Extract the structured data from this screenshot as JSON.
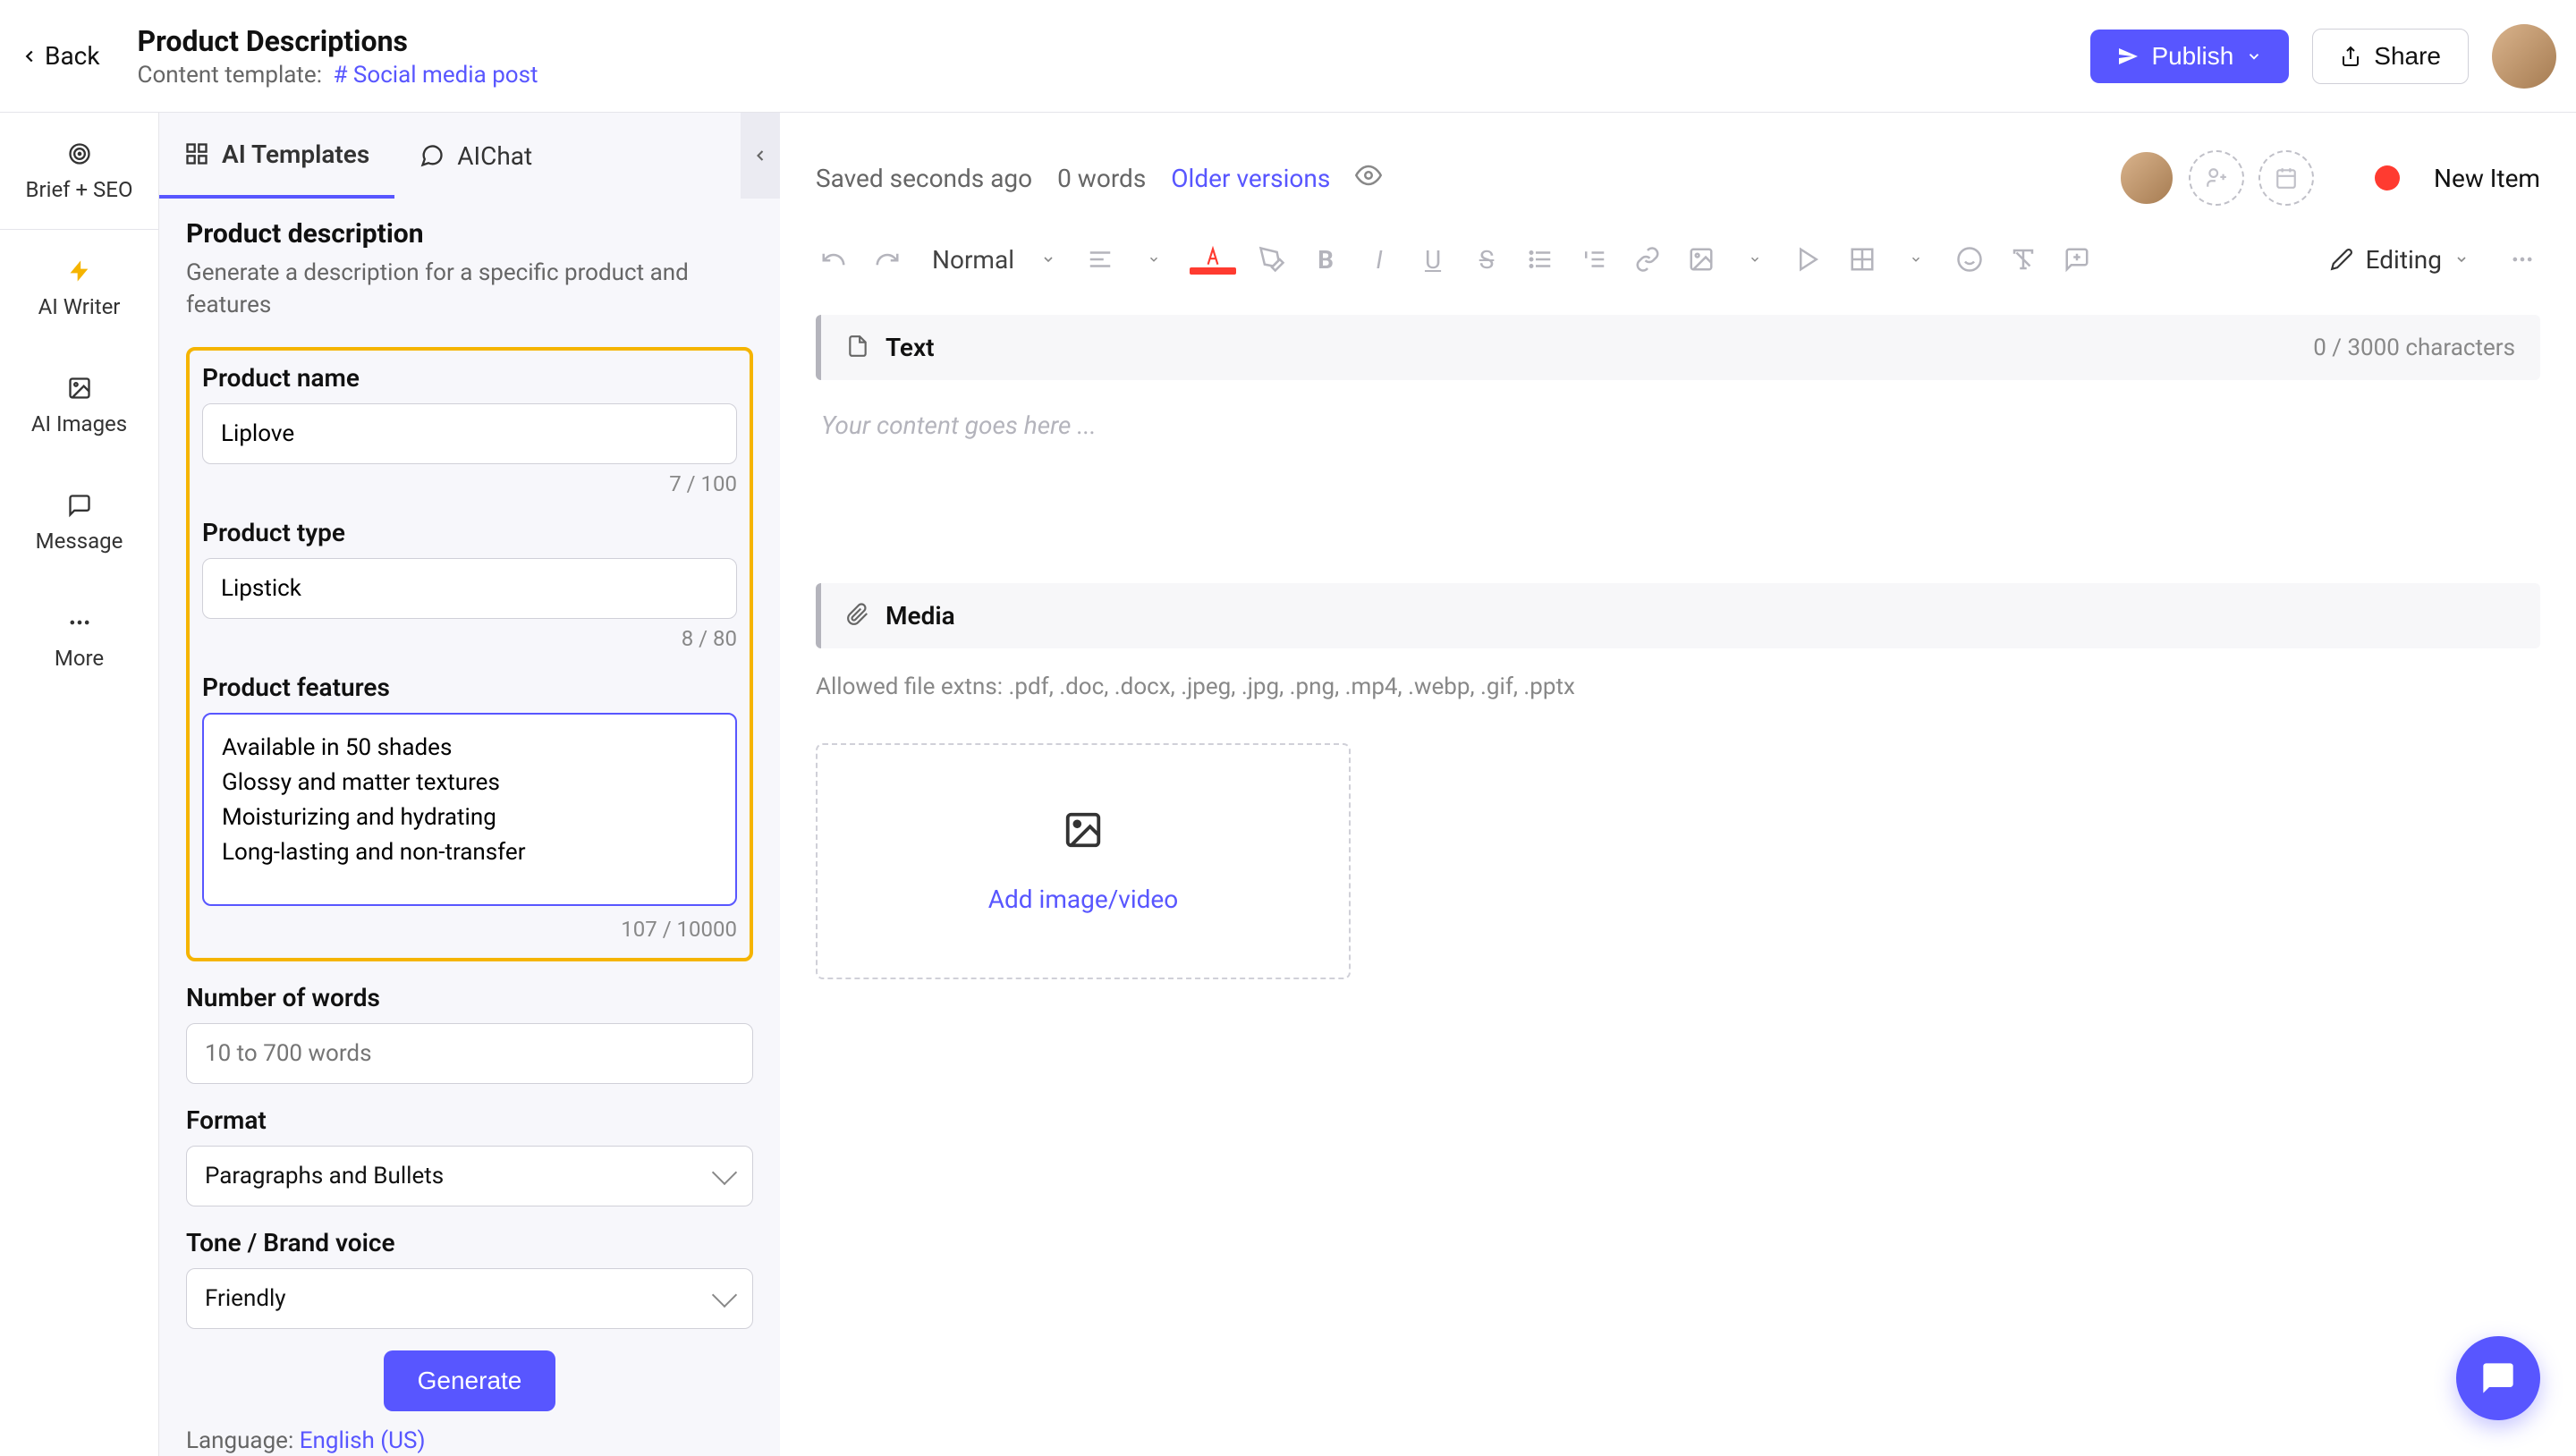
{
  "header": {
    "back_label": "Back",
    "title": "Product Descriptions",
    "subtitle_prefix": "Content template:",
    "template_tag": "Social media post",
    "publish_label": "Publish",
    "share_label": "Share"
  },
  "leftnav": {
    "items": [
      {
        "label": "Brief + SEO"
      },
      {
        "label": "AI Writer"
      },
      {
        "label": "AI Images"
      },
      {
        "label": "Message"
      },
      {
        "label": "More"
      }
    ]
  },
  "panel": {
    "tab_templates": "AI Templates",
    "tab_chat": "AIChat",
    "section_title": "Product description",
    "section_desc": "Generate a description for a specific product and features",
    "product_name_label": "Product name",
    "product_name_value": "Liplove",
    "product_name_count": "7 / 100",
    "product_type_label": "Product type",
    "product_type_value": "Lipstick",
    "product_type_count": "8 / 80",
    "features_label": "Product features",
    "features_value": "Available in 50 shades\nGlossy and matter textures\nMoisturizing and hydrating\nLong-lasting and non-transfer",
    "features_count": "107 / 10000",
    "numwords_label": "Number of words",
    "numwords_placeholder": "10 to 700 words",
    "format_label": "Format",
    "format_value": "Paragraphs and Bullets",
    "tone_label": "Tone / Brand voice",
    "tone_value": "Friendly",
    "generate_label": "Generate",
    "language_prefix": "Language:",
    "language_value": "English (US)"
  },
  "editor": {
    "saved_text": "Saved seconds ago",
    "word_count": "0 words",
    "older_versions": "Older versions",
    "status_label": "New Item",
    "style_select": "Normal",
    "mode_label": "Editing",
    "text_block_label": "Text",
    "text_char_counter": "0 / 3000 characters",
    "text_placeholder": "Your content goes here ...",
    "media_label": "Media",
    "media_hint": "Allowed file extns: .pdf, .doc, .docx, .jpeg, .jpg, .png, .mp4, .webp, .gif, .pptx",
    "media_add_text": "Add image/video"
  }
}
